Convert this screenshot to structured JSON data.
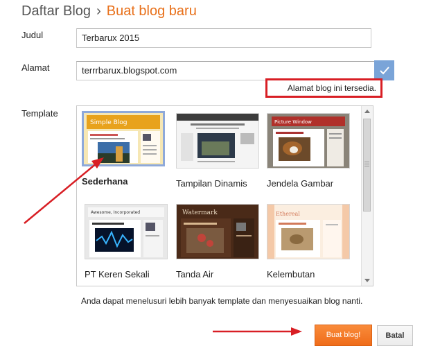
{
  "header": {
    "breadcrumb": "Daftar Blog",
    "separator": "›",
    "current": "Buat blog baru"
  },
  "form": {
    "title_label": "Judul",
    "title_value": "Terbarux 2015",
    "address_label": "Alamat",
    "address_value": "terrrbarux.blogspot.com",
    "address_status": "Alamat blog ini tersedia.",
    "template_label": "Template"
  },
  "templates": [
    {
      "name": "Sederhana",
      "selected": true,
      "thumb_title": "Simple Blog"
    },
    {
      "name": "Tampilan Dinamis",
      "selected": false
    },
    {
      "name": "Jendela Gambar",
      "selected": false,
      "thumb_title": "Picture Window"
    },
    {
      "name": "PT Keren Sekali",
      "selected": false,
      "thumb_title": "Awesome, Incorporated"
    },
    {
      "name": "Tanda Air",
      "selected": false,
      "thumb_title": "Watermark"
    },
    {
      "name": "Kelembutan",
      "selected": false,
      "thumb_title": "Ethereal"
    }
  ],
  "hint": "Anda dapat menelusuri lebih banyak template dan menyesuaikan blog nanti.",
  "actions": {
    "create": "Buat blog!",
    "cancel": "Batal"
  },
  "colors": {
    "accent": "#e8701a",
    "check_button": "#7aa4d8",
    "annotation": "#d81e24",
    "selected_border": "#8ea9da"
  },
  "icons": {
    "check": "check-icon",
    "scroll_up": "arrow-up-icon",
    "scroll_down": "arrow-down-icon"
  }
}
